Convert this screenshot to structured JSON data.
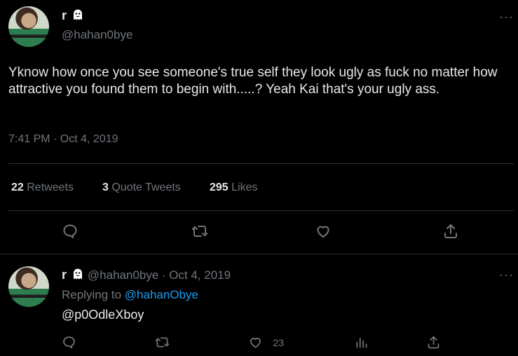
{
  "main": {
    "author": {
      "name": "r",
      "handle": "@hahan0bye"
    },
    "text": "Yknow how once you see someone's true self they look ugly as fuck no matter how attractive you found them to begin with.....? Yeah Kai that's your ugly ass.",
    "timestamp": "7:41 PM · Oct 4, 2019",
    "stats": {
      "retweets_count": "22",
      "retweets_label": "Retweets",
      "quotes_count": "3",
      "quotes_label": "Quote Tweets",
      "likes_count": "295",
      "likes_label": "Likes"
    },
    "more": "···"
  },
  "reply": {
    "author": {
      "name": "r",
      "handle": "@hahan0bye"
    },
    "date": "· Oct 4, 2019",
    "replying_prefix": "Replying to",
    "replying_handle": "@hahanObye",
    "text": "@p0OdleXboy",
    "likes_count": "23",
    "more": "···"
  },
  "icons": [
    "ghost-icon",
    "reply-icon",
    "retweet-icon",
    "like-icon",
    "share-icon",
    "analytics-icon",
    "more-icon"
  ],
  "colors": {
    "background": "#000000",
    "text": "#e7e9ea",
    "secondary": "#71767b",
    "link": "#1d9bf0",
    "divider": "#2f3336"
  }
}
